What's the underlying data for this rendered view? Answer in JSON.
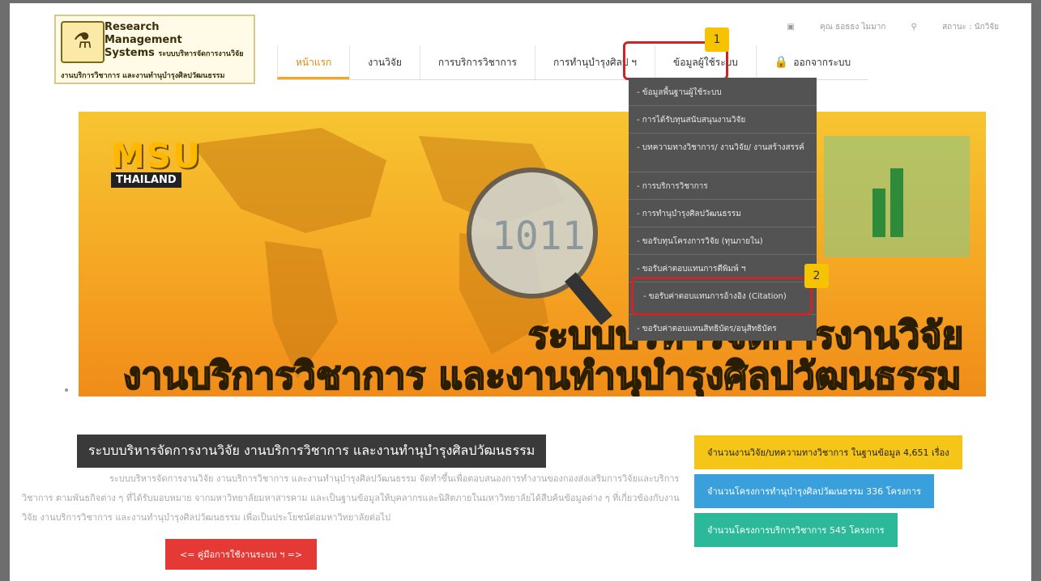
{
  "logo": {
    "line1": "Research",
    "line2": "Management",
    "line3": "Systems",
    "line3_suffix": "ระบบบริหารจัดการงานวิจัย",
    "subtitle": "งานบริการวิชาการ และงานทำนุบำรุงศิลปวัฒนธรรม"
  },
  "topbar": {
    "user": "คุณ ธอธธง ไมมาก",
    "status": "สถานะ : นักวิจัย"
  },
  "nav": {
    "items": [
      {
        "label": "หน้าแรก"
      },
      {
        "label": "งานวิจัย"
      },
      {
        "label": "การบริการวิชาการ"
      },
      {
        "label": "การทำนุบำรุงศิลป ฯ"
      },
      {
        "label": "ข้อมูลผู้ใช้ระบบ"
      },
      {
        "label": "ออกจากระบบ"
      }
    ]
  },
  "badges": {
    "one": "1",
    "two": "2"
  },
  "banner": {
    "brand": "MSU",
    "country": "THAILAND",
    "line1": "ระบบบริหารจัดการงานวิจัย",
    "line2": "งานบริการวิชาการ และงานทำนุบำรุงศิลปวัฒนธรรม"
  },
  "dropdown": {
    "items": [
      {
        "label": "- ข้อมูลพื้นฐานผู้ใช้ระบบ"
      },
      {
        "label": "- การได้รับทุนสนับสนุนงานวิจัย"
      },
      {
        "label": "- บทความทางวิชาการ/ งานวิจัย/ งานสร้างสรรค์"
      },
      {
        "label": "- การบริการวิชาการ"
      },
      {
        "label": "- การทำนุบำรุงศิลปวัฒนธรรม"
      },
      {
        "label": "- ขอรับทุนโครงการวิจัย (ทุนภายใน)"
      },
      {
        "label": "- ขอรับค่าตอบแทนการตีพิมพ์ ฯ"
      },
      {
        "label": "- ขอรับค่าตอบแทนการอ้างอิง (Citation)"
      },
      {
        "label": "- ขอรับค่าตอบแทนสิทธิบัตร/อนุสิทธิบัตร"
      }
    ]
  },
  "main": {
    "title": "ระบบบริหารจัดการงานวิจัย งานบริการวิชาการ และงานทำนุบำรุงศิลปวัฒนธรรม",
    "description": "ระบบบริหารจัดการงานวิจัย งานบริการวิชาการ และงานทำนุบำรุงศิลปวัฒนธรรม จัดทำขึ้นเพื่อตอบสนองการทำงานของกองส่งเสริมการวิจัยและบริการวิชาการ ตามพันธกิจต่าง ๆ ที่ได้รับมอบหมาย จากมหาวิทยาลัยมหาสารคาม และเป็นฐานข้อมูลให้บุคลากรและนิสิตภายในมหาวิทยาลัยได้สืบค้นข้อมูลต่าง ๆ ที่เกี่ยวข้องกับงานวิจัย งานบริการวิชาการ และงานทำนุบำรุงศิลปวัฒนธรรม เพื่อเป็นประโยชน์ต่อมหาวิทยาลัยต่อไป",
    "manual_button": "<= คู่มือการใช้งานระบบ ฯ =>"
  },
  "stats": {
    "research": "จำนวนงานวิจัย/บทความทางวิชาการ ในฐานข้อมูล 4,651 เรื่อง",
    "culture": "จำนวนโครงการทำนุบำรุงศิลปวัฒนธรรม 336 โครงการ",
    "service": "จำนวนโครงการบริการวิชาการ 545 โครงการ"
  },
  "colors": {
    "accent": "#f5a623",
    "highlight_box": "#c62828",
    "badge": "#f5c300",
    "dropdown_bg": "#535353"
  }
}
